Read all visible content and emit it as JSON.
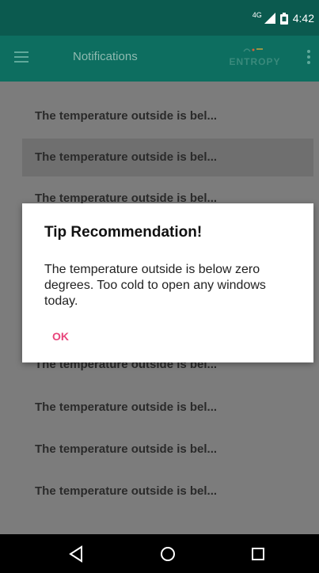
{
  "status_bar": {
    "network": "4G",
    "time": "4:42"
  },
  "app_bar": {
    "title": "Notifications",
    "logo_text": "ENTROPY",
    "menu_icon": "hamburger-menu-icon",
    "overflow_icon": "vertical-dots-icon"
  },
  "notifications": [
    {
      "text": "The temperature outside is bel..."
    },
    {
      "text": "The temperature outside is bel..."
    },
    {
      "text": "The temperature outside is bel..."
    },
    {
      "text": "The temperature outside is bel..."
    },
    {
      "text": "The temperature outside is bel..."
    },
    {
      "text": "The temperature outside is bel..."
    },
    {
      "text": "The temperature outside is bel..."
    }
  ],
  "dialog": {
    "title": "Tip Recommendation!",
    "message": "The temperature outside is below zero degrees. Too cold to open any windows today.",
    "ok_label": "OK"
  },
  "nav_bar": {
    "back_icon": "back-triangle-icon",
    "home_icon": "home-circle-icon",
    "recent_icon": "recent-apps-square-icon"
  },
  "colors": {
    "status_bar": "#0b5a4f",
    "app_bar": "#0d6e60",
    "overlay": "#7c7c7c",
    "ok_button": "#e8457b"
  }
}
